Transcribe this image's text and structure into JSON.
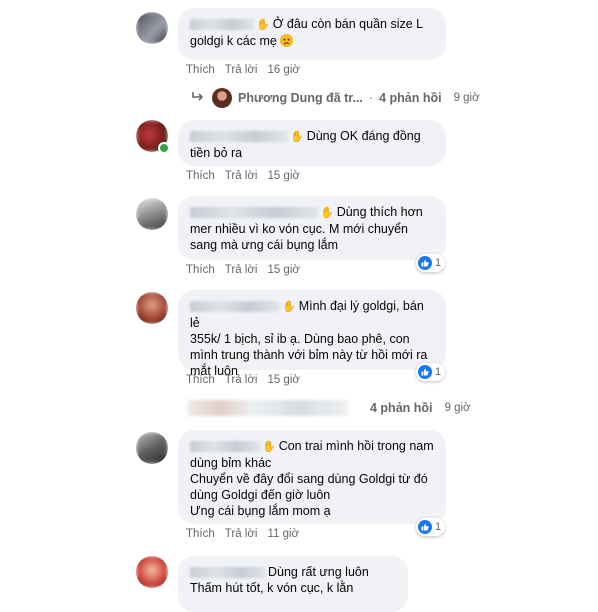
{
  "colors": {
    "bubble_bg": "#f0f2f5",
    "meta_text": "#65676b",
    "like_blue": "#1877f2",
    "online_green": "#31a24c"
  },
  "comments": [
    {
      "text_line1": "Ở đâu còn bán quần size L",
      "text_line2": "goldgi k các mẹ",
      "emoji": "angry-face-icon",
      "actions": {
        "like": "Thích",
        "reply": "Trả lời",
        "time": "16 giờ"
      },
      "replies": {
        "name": "Phương Dung đã tr...",
        "count": "4 phản hồi",
        "time": "9 giờ"
      }
    },
    {
      "text_line1": "Dùng OK đáng đồng",
      "text_line2": "tiền bỏ ra",
      "actions": {
        "like": "Thích",
        "reply": "Trả lời",
        "time": "15 giờ"
      }
    },
    {
      "text_line1": "Dùng thích hơn",
      "text_line2": "mer nhiều vì ko vón cục. M mới chuyển",
      "text_line3": "sang mà ưng cái bụng lắm",
      "actions": {
        "like": "Thích",
        "reply": "Trả lời",
        "time": "15 giờ"
      },
      "reaction_count": "1"
    },
    {
      "text_line1": "Mình đại lý goldgi, bán lẻ",
      "text_line2": "355k/ 1 bịch, sỉ ib ạ. Dùng bao phê, con",
      "text_line3": "mình trung thành với bỉm này từ hồi mới ra",
      "text_line4": "mắt luôn",
      "actions": {
        "like": "Thích",
        "reply": "Trả lời",
        "time": "15 giờ"
      },
      "reaction_count": "1",
      "replies": {
        "count": "4 phản hồi",
        "time": "9 giờ"
      }
    },
    {
      "text_line1": "Con trai mình hồi trong nam",
      "text_line2": "dùng bỉm khác",
      "text_line3": "Chuyển về đây đổi sang dùng Goldgi từ đó",
      "text_line4": "dùng Goldgi đến giờ luôn",
      "text_line5": "Ưng cái bụng lắm mom ạ",
      "actions": {
        "like": "Thích",
        "reply": "Trả lời",
        "time": "11 giờ"
      },
      "reaction_count": "1"
    },
    {
      "text_line1": "Dùng rất ưng luôn",
      "text_line2": "Thấm hút tốt, k vón cục, k lằn"
    }
  ]
}
